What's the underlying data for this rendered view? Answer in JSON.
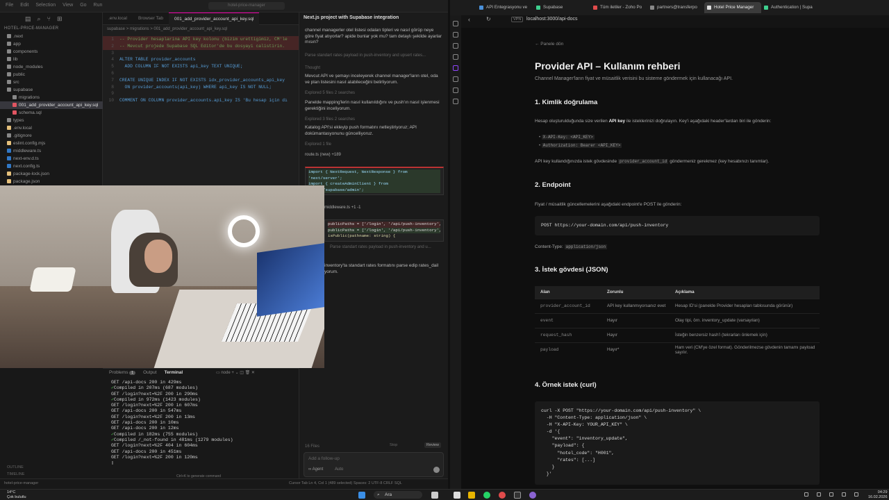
{
  "ide": {
    "menu": [
      "File",
      "Edit",
      "Selection",
      "View",
      "Go",
      "Run"
    ],
    "command_center": "hotel-price-manager",
    "explorer_project": "HOTEL-PRICE-MANAGER",
    "tree": [
      {
        "label": ".next",
        "color": "#888"
      },
      {
        "label": "app",
        "color": "#888"
      },
      {
        "label": "components",
        "color": "#888"
      },
      {
        "label": "lib",
        "color": "#888"
      },
      {
        "label": "node_modules",
        "color": "#888"
      },
      {
        "label": "public",
        "color": "#888"
      },
      {
        "label": "src",
        "color": "#888"
      },
      {
        "label": "supabase",
        "color": "#888"
      },
      {
        "label": "migrations",
        "color": "#888"
      },
      {
        "label": "001_add_provider_account_api_key.sql",
        "color": "#e05561",
        "selected": true
      },
      {
        "label": "schema.sql",
        "color": "#e05561"
      },
      {
        "label": "types",
        "color": "#888"
      },
      {
        "label": ".env.local",
        "color": "#e5c07b"
      },
      {
        "label": ".gitignore",
        "color": "#888"
      },
      {
        "label": "eslint.config.mjs",
        "color": "#e5c07b"
      },
      {
        "label": "middleware.ts",
        "color": "#3178c6"
      },
      {
        "label": "next-env.d.ts",
        "color": "#3178c6"
      },
      {
        "label": "next.config.ts",
        "color": "#3178c6"
      },
      {
        "label": "package-lock.json",
        "color": "#e5c07b"
      },
      {
        "label": "package.json",
        "color": "#e5c07b"
      }
    ],
    "tabs": [
      ".env.local",
      "Browser Tab",
      "001_add_provider_account_api_key.sql"
    ],
    "breadcrumb": "supabase > migrations > 001_add_provider_account_api_key.sql",
    "code": [
      {
        "n": "1",
        "t": "-- Provider hesaplarina API key kolonu (bizim urettigimiz, CM'le",
        "c": "cmt",
        "del": true
      },
      {
        "n": "2",
        "t": "-- Mevcut projede Supabase SQL Editor'de bu dosyayi calistirin.",
        "c": "cmt",
        "del": true
      },
      {
        "n": "3",
        "t": "",
        "c": ""
      },
      {
        "n": "4",
        "t": "ALTER TABLE provider_accounts",
        "c": "kw"
      },
      {
        "n": "5",
        "t": "  ADD COLUMN IF NOT EXISTS api_key TEXT UNIQUE;",
        "c": "kw"
      },
      {
        "n": "6",
        "t": "",
        "c": ""
      },
      {
        "n": "7",
        "t": "CREATE UNIQUE INDEX IF NOT EXISTS idx_provider_accounts_api_key",
        "c": "kw"
      },
      {
        "n": "8",
        "t": "  ON provider_accounts(api_key) WHERE api_key IS NOT NULL;",
        "c": "kw"
      },
      {
        "n": "9",
        "t": "",
        "c": ""
      },
      {
        "n": "10",
        "t": "COMMENT ON COLUMN provider_accounts.api_key IS 'Bu hesap için dı",
        "c": "kw"
      }
    ],
    "chat": {
      "title": "Next.js project with Supabase integration",
      "question": "channel managerler otel listesi odaları tipleri ve nasıl görüp neye göre fiyat atıyorlar? apide bunlar yok mu? tam detaylı şekilde ayarlar mısın?",
      "step1": "Parse standart rates payload in push-inventory and upsert rates...",
      "thought": "Thought",
      "p1": "Mevcut API ve şemayı inceleyerek channel manager'ların otel, oda ve plan listesini nasıl alabileceğini belirliyorum.",
      "explored1": "Explored 5 files 2 searches",
      "p2": "Panelde mapping'lerin nasıl kullanıldığını ve push'ın nasıl işlenmesi gerektiğini inceliyorum.",
      "explored2": "Explored 3 files 2 searches",
      "p3": "Katalog API'si ekleyip push formatını netleştiriyoruz; API dokümantasyonunu güncelliyoruz.",
      "explored3": "Explored 1 file",
      "file1": "route.ts (new) +189",
      "diff1": [
        "import { NextRequest, NextResponse } from 'next/server';",
        "import { createAdminClient } from '@/lib/supabase/admin';"
      ],
      "file2": "middleware.ts +1 -1",
      "diff2": [
        "publicPaths = ['/login', '/api/push-inventory', '/ap",
        "publicPaths = ['/login', '/api/push-inventory', '/ap",
        "isPublic(pathname: string) {"
      ],
      "step2": "Parse standart rates payload in push-inventory and u...",
      "p4": "inventory'ta standart rates formatını parse edip rates_dail yorum.",
      "files_count": "16 Files",
      "stop": "Stop",
      "review": "Review",
      "input_placeholder": "Add a follow-up",
      "agent": "Agent",
      "auto": "Auto"
    },
    "terminal": {
      "tabs": [
        "Problems",
        "Output",
        "Terminal"
      ],
      "problems_count": "1",
      "shell": "node",
      "lines": [
        {
          "ok": false,
          "t": "GET /api-docs 200 in 429ms"
        },
        {
          "ok": true,
          "t": "Compiled in 207ms (687 modules)"
        },
        {
          "ok": false,
          "t": "GET /login?next=%2F 200 in 290ms"
        },
        {
          "ok": true,
          "t": "Compiled in 972ms (1423 modules)"
        },
        {
          "ok": false,
          "t": "GET /login?next=%2F 200 in 607ms"
        },
        {
          "ok": false,
          "t": "GET /api-docs 200 in 547ms"
        },
        {
          "ok": false,
          "t": "GET /login?next=%2F 200 in 13ms"
        },
        {
          "ok": false,
          "t": "GET /api-docs 200 in 10ms"
        },
        {
          "ok": false,
          "t": "GET /api-docs 200 in 12ms"
        },
        {
          "ok": true,
          "t": "Compiled in 182ms (755 modules)"
        },
        {
          "ok": true,
          "t": "Compiled /_not-found in 481ms (1279 modules)"
        },
        {
          "ok": false,
          "t": "GET /login?next=%2F 404 in 604ms"
        },
        {
          "ok": false,
          "t": "GET /api-docs 200 in 451ms"
        },
        {
          "ok": false,
          "t": "GET /login?next=%2F 200 in 120ms"
        }
      ],
      "hint": "Ctrl+K to generate command"
    },
    "outline": [
      "OUTLINE",
      "TIMELINE"
    ],
    "status_left": "hotel-price-manager",
    "status_right": "Cursor Tab   Ln 4, Col 1 (489 selected)   Spaces: 2   UTF-8   CRLF   SQL"
  },
  "browser": {
    "tabs": [
      {
        "label": "API Entegrasyonu ve",
        "fav": "#4a90d9"
      },
      {
        "label": "Supabase",
        "fav": "#3ecf8e"
      },
      {
        "label": "Tüm iletiler - Zoho Po",
        "fav": "#e04b4b"
      },
      {
        "label": "partners@transferpo",
        "fav": "#888"
      },
      {
        "label": "Hotel Price Manager",
        "fav": "#ddd",
        "active": true
      },
      {
        "label": "Authentication | Supa",
        "fav": "#3ecf8e"
      }
    ],
    "vpn": "VPN",
    "url": "localhost:3000/api-docs",
    "back": "← Panele dön",
    "title": "Provider API – Kullanım rehberi",
    "subtitle": "Channel Manager'ların fiyat ve müsaitlik verisini bu sisteme göndermek için kullanacağı API.",
    "s1": "1. Kimlik doğrulama",
    "s1_text_a": "Hesap oluşturulduğunda size verilen ",
    "s1_text_b": "API key",
    "s1_text_c": " ile isteklerinizi doğrulayın. Key'i aşağıdaki header'lardan biri ile gönderin:",
    "s1_b1": "X-API-Key: <API_KEY>",
    "s1_b2": "Authorization: Bearer <API_KEY>",
    "s1_note_a": "API key kullandığınızda istek gövdesinde ",
    "s1_note_code": "provider_account_id",
    "s1_note_b": " göndermeniz gerekmez (key hesabınızı tanımlar).",
    "s2": "2. Endpoint",
    "s2_text": "Fiyat / müsaitlik güncellemelerini aşağıdaki endpoint'e POST ile gönderin:",
    "s2_code": "POST https://your-domain.com/api/push-inventory",
    "s2_ct_a": "Content-Type: ",
    "s2_ct_code": "application/json",
    "s3": "3. İstek gövdesi (JSON)",
    "table_head": [
      "Alan",
      "Zorunlu",
      "Açıklama"
    ],
    "table_rows": [
      {
        "f": "provider_account_id",
        "r": "API key kullanmıyorsanız evet",
        "d": "Hesap ID'si (panelde Provider hesapları tablosunda görünür)"
      },
      {
        "f": "event",
        "r": "Hayır",
        "d": "Olay tipi, örn. inventory_update (varsayılan)"
      },
      {
        "f": "request_hash",
        "r": "Hayır",
        "d": "İsteğin benzersiz hash'i (tekrarları önlemek için)"
      },
      {
        "f": "payload",
        "r": "Hayır*",
        "d": "Ham veri (CM'ye özel format). Gönderilmezse gövdenin tamamı payload sayılır."
      }
    ],
    "s4": "4. Örnek istek (curl)",
    "curl": [
      "curl -X POST \"https://your-domain.com/api/push-inventory\" \\",
      "  -H \"Content-Type: application/json\" \\",
      "  -H \"X-API-Key: YOUR_API_KEY\" \\",
      "  -d '{",
      "    \"event\": \"inventory_update\",",
      "    \"payload\": {",
      "      \"hotel_code\": \"H001\",",
      "      \"rates\": [...]",
      "    }",
      "  }'"
    ]
  },
  "taskbar": {
    "temp": "14°C",
    "weather": "Çok bulutlu",
    "search": "Ara",
    "time": "04:29",
    "date": "16.02.2026"
  }
}
